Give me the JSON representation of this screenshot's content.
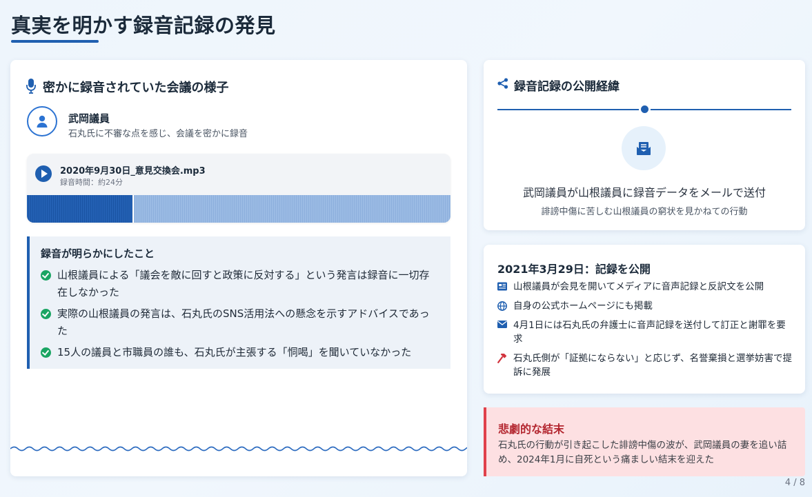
{
  "page": {
    "title": "真実を明かす録音記録の発見",
    "page_number": "4 / 8"
  },
  "recording": {
    "heading": "密かに録音されていた会議の様子",
    "person": {
      "name": "武岡議員",
      "description": "石丸氏に不審な点を感じ、会議を密かに録音"
    },
    "audio": {
      "file_name": "2020年9月30日_意見交換会.mp3",
      "duration": "録音時間：約24分",
      "progress": 0.25
    },
    "findings_title": "録音が明らかにしたこと",
    "findings": [
      "山根議員による「議会を敵に回すと政策に反対する」という発言は録音に一切存在しなかった",
      "実際の山根議員の発言は、石丸氏のSNS活用法への懸念を示すアドバイスであった",
      "15人の議員と市職員の誰も、石丸氏が主張する「恫喝」を聞いていなかった"
    ]
  },
  "flow": {
    "heading": "録音記録の公開経緯",
    "main": "武岡議員が山根議員に録音データをメールで送付",
    "sub": "誹謗中傷に苦しむ山根議員の窮状を見かねての行動"
  },
  "publish": {
    "heading": "2021年3月29日：記録を公開",
    "items": [
      {
        "icon": "newspaper-icon",
        "text": "山根議員が会見を開いてメディアに音声記録と反訳文を公開"
      },
      {
        "icon": "globe-icon",
        "text": "自身の公式ホームページにも掲載"
      },
      {
        "icon": "envelope-icon",
        "text": "4月1日には石丸氏の弁護士に音声記録を送付して訂正と謝罪を要求"
      },
      {
        "icon": "gavel-icon",
        "text": "石丸氏側が「証拠にならない」と応じず、名誉棄損と選挙妨害で提訴に発展"
      }
    ]
  },
  "tragic": {
    "title": "悲劇的な結末",
    "text": "石丸氏の行動が引き起こした誹謗中傷の波が、武岡議員の妻を追い詰め、2024年1月に自死という痛ましい結末を迎えた"
  },
  "colors": {
    "accent": "#1f5fb0",
    "success": "#1aa563",
    "danger": "#e0414b"
  }
}
